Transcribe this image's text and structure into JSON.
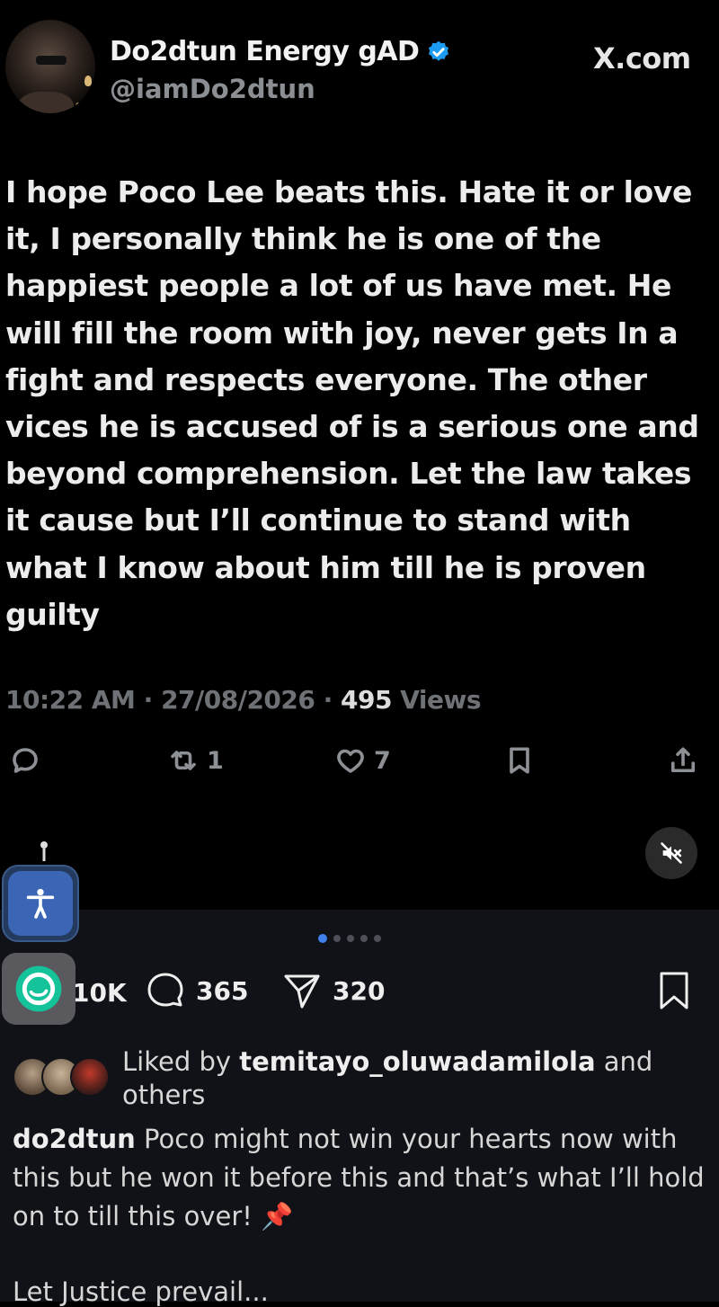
{
  "tweet": {
    "display_name": "Do2dtun Energy gAD",
    "handle": "@iamDo2dtun",
    "source": "X.com",
    "text": "I hope Poco Lee beats this. Hate it or love it, I personally think he is one of the happiest people a lot of us have met. He will fill the room with joy, never gets In a fight and respects everyone. The other vices he is accused of is a serious one and beyond comprehension. Let the law takes it cause but I’ll continue to stand with what I know about him till he is proven guilty",
    "time": "10:22 AM",
    "date": "27/08/2026",
    "views_count": "495",
    "views_label": "Views",
    "retweets": "1",
    "likes": "7",
    "icons": [
      "reply-icon",
      "retweet-icon",
      "like-icon",
      "bookmark-icon",
      "share-icon",
      "verified-icon"
    ],
    "verified_color": "#1d9bf0"
  },
  "instagram": {
    "likes": "10K",
    "comments": "365",
    "shares": "320",
    "carousel_dots": 5,
    "carousel_active": 0,
    "liked_by_prefix": "Liked by",
    "liked_by_user": "temitayo_oluwadamilola",
    "liked_by_suffix": "and others",
    "caption_user": "do2dtun",
    "caption_text": "Poco might not win your hearts now with this but he won it before this and that’s what I’ll hold on to till this over! 📌",
    "caption_line2": "Let Justice prevail...",
    "accent": "#3f80ea"
  },
  "overlay": {
    "icons": [
      "accessibility-icon",
      "grammar-app-icon",
      "mute-icon"
    ]
  }
}
